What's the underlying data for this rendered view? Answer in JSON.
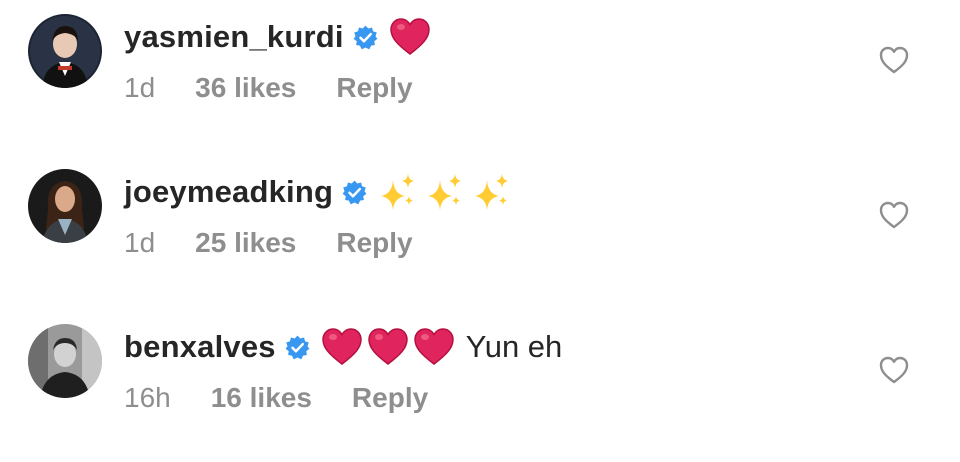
{
  "comments": [
    {
      "username": "yasmien_kurdi",
      "verified": true,
      "text": "",
      "emojis": [
        "red-heart"
      ],
      "time": "1d",
      "likes": "36 likes",
      "reply": "Reply"
    },
    {
      "username": "joeymeadking",
      "verified": true,
      "text": "",
      "emojis": [
        "sparkles",
        "sparkles",
        "sparkles"
      ],
      "time": "1d",
      "likes": "25 likes",
      "reply": "Reply"
    },
    {
      "username": "benxalves",
      "verified": true,
      "text": "Yun eh",
      "emojis": [
        "red-heart",
        "red-heart",
        "red-heart"
      ],
      "time": "16h",
      "likes": "16 likes",
      "reply": "Reply"
    }
  ],
  "colors": {
    "username": "#262626",
    "meta": "#8e8e8e",
    "verified_badge": "#3897f0",
    "heart_emoji": "#e0245e",
    "sparkle_emoji": "#ffcc33",
    "like_icon": "#8e8e8e"
  },
  "icons": {
    "verified": "verified-badge-icon",
    "like": "heart-outline-icon"
  }
}
